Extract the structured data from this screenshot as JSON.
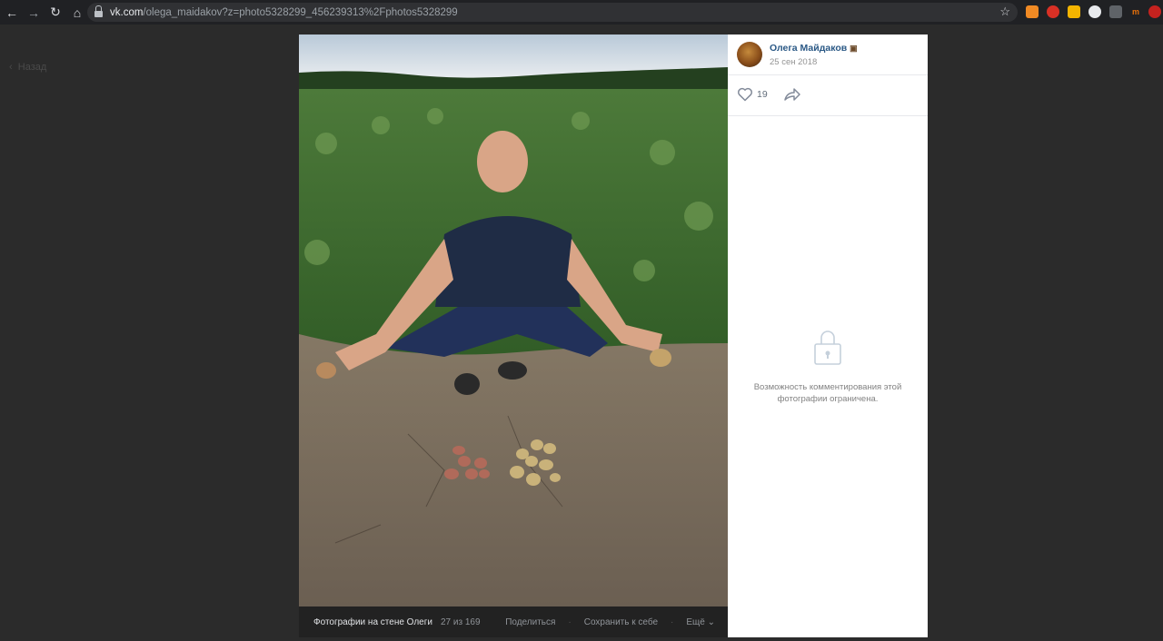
{
  "browser": {
    "url_host": "vk.com",
    "url_path": "/olega_maidakov?z=photo5328299_456239313%2Fphotos5328299"
  },
  "page": {
    "back_label": "Назад"
  },
  "viewer": {
    "album_title": "Фотографии на стене Олеги",
    "counter": "27 из 169",
    "share_label": "Поделиться",
    "save_label": "Сохранить к себе",
    "more_label": "Ещё"
  },
  "post": {
    "author_name": "Олега Майдаков",
    "date": "25 сен 2018",
    "likes_count": "19",
    "comments_restricted_text": "Возможность комментирования этой фотографии ограничена."
  },
  "colors": {
    "link": "#2a5885",
    "muted": "#939393"
  },
  "icons": [
    "back-arrow-icon",
    "forward-arrow-icon",
    "reload-icon",
    "home-icon",
    "lock-icon",
    "star-icon",
    "heart-icon",
    "share-arrow-icon",
    "padlock-icon",
    "chevron-down-icon"
  ]
}
